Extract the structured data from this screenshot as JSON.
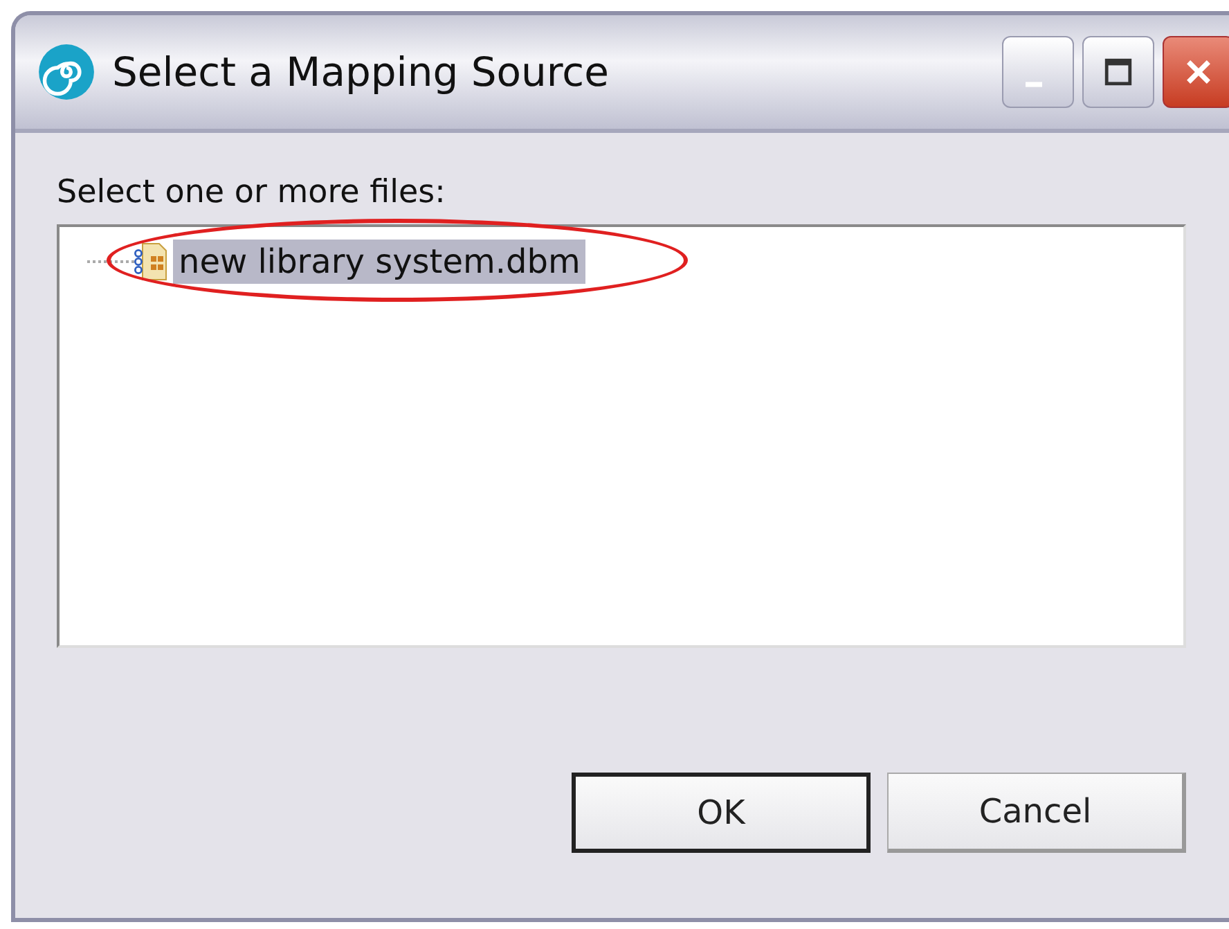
{
  "window": {
    "title": "Select a Mapping Source"
  },
  "prompt": "Select one or more files:",
  "files": [
    {
      "name": "new library system.dbm",
      "selected": true,
      "circled": true
    }
  ],
  "buttons": [
    {
      "label": "OK",
      "default": true
    },
    {
      "label": "Cancel",
      "default": false
    }
  ]
}
